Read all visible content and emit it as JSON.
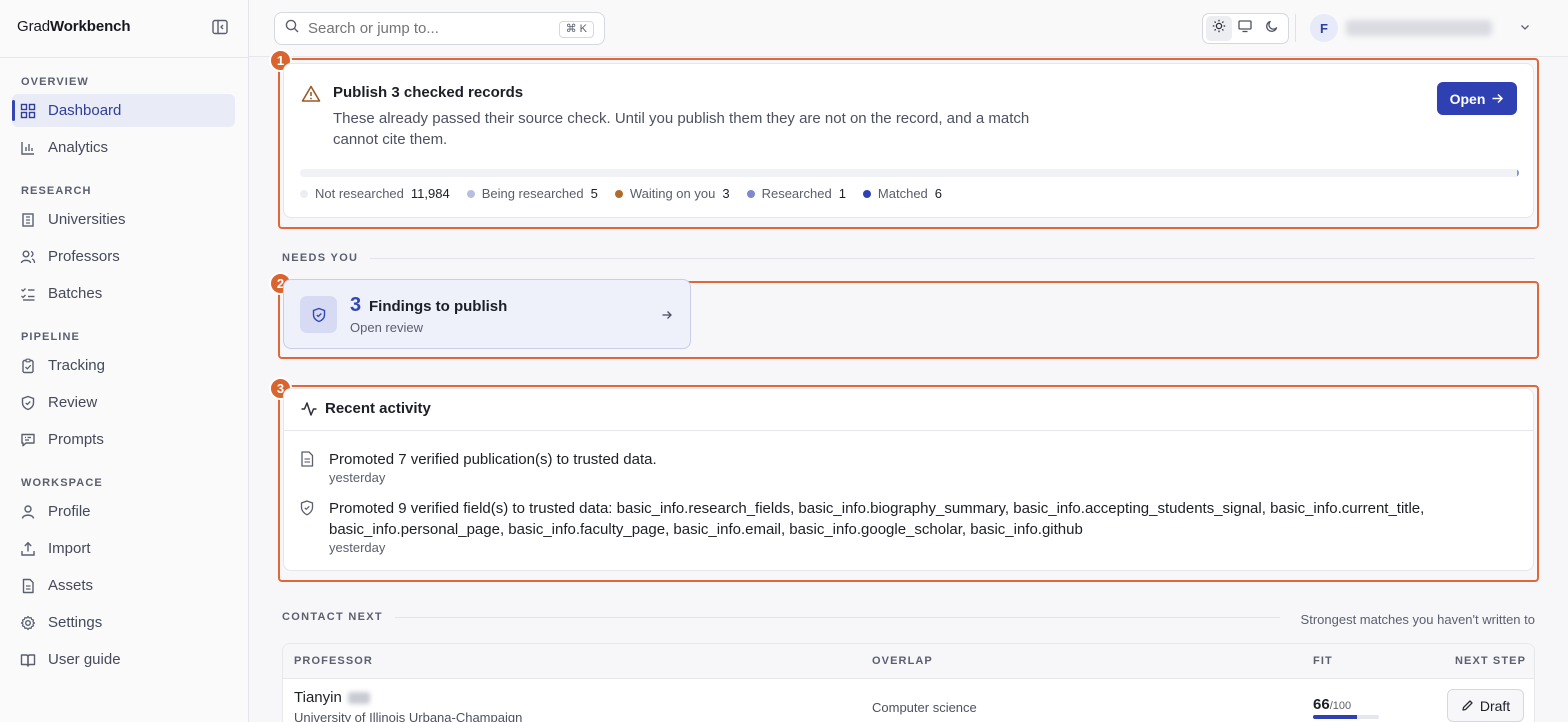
{
  "brand": {
    "prefix": "Grad",
    "bold": "Workbench"
  },
  "sidebar": {
    "groups": [
      {
        "heading": "OVERVIEW",
        "items": [
          {
            "label": "Dashboard",
            "icon": "grid-icon",
            "active": true
          },
          {
            "label": "Analytics",
            "icon": "bar-chart-icon"
          }
        ]
      },
      {
        "heading": "RESEARCH",
        "items": [
          {
            "label": "Universities",
            "icon": "building-icon"
          },
          {
            "label": "Professors",
            "icon": "users-icon"
          },
          {
            "label": "Batches",
            "icon": "list-checks-icon"
          }
        ]
      },
      {
        "heading": "PIPELINE",
        "items": [
          {
            "label": "Tracking",
            "icon": "clipboard-icon"
          },
          {
            "label": "Review",
            "icon": "shield-icon"
          },
          {
            "label": "Prompts",
            "icon": "message-icon"
          }
        ]
      },
      {
        "heading": "WORKSPACE",
        "items": [
          {
            "label": "Profile",
            "icon": "user-icon"
          },
          {
            "label": "Import",
            "icon": "upload-icon"
          },
          {
            "label": "Assets",
            "icon": "file-icon"
          },
          {
            "label": "Settings",
            "icon": "gear-icon"
          },
          {
            "label": "User guide",
            "icon": "book-icon"
          }
        ]
      }
    ]
  },
  "topbar": {
    "search_placeholder": "Search or jump to...",
    "shortcut": "⌘ K",
    "avatar_initial": "F"
  },
  "callout": {
    "badge": "1",
    "title": "Publish 3 checked records",
    "description": "These already passed their source check. Until you publish them they are not on the record, and a match cannot cite them.",
    "open_label": "Open",
    "progress_fill": 0.001,
    "legend": [
      {
        "label": "Not researched",
        "value": "11,984",
        "color": "#eceef2"
      },
      {
        "label": "Being researched",
        "value": "5",
        "color": "#b7bfe0"
      },
      {
        "label": "Waiting on you",
        "value": "3",
        "color": "#b06a2c"
      },
      {
        "label": "Researched",
        "value": "1",
        "color": "#7c88cf"
      },
      {
        "label": "Matched",
        "value": "6",
        "color": "#2f40b2"
      }
    ]
  },
  "needs_you": {
    "heading": "NEEDS YOU",
    "badge": "2",
    "card": {
      "count": "3",
      "title": "Findings to publish",
      "subtitle": "Open review"
    }
  },
  "activity": {
    "badge": "3",
    "title": "Recent activity",
    "items": [
      {
        "text": "Promoted 7 verified publication(s) to trusted data.",
        "time": "yesterday",
        "icon": "document-icon"
      },
      {
        "text": "Promoted 9 verified field(s) to trusted data: basic_info.research_fields, basic_info.biography_summary, basic_info.accepting_students_signal, basic_info.current_title, basic_info.personal_page, basic_info.faculty_page, basic_info.email, basic_info.google_scholar, basic_info.github",
        "time": "yesterday",
        "icon": "shield-check-icon"
      }
    ]
  },
  "contact": {
    "heading": "CONTACT NEXT",
    "note": "Strongest matches you haven't written to",
    "columns": [
      "PROFESSOR",
      "OVERLAP",
      "FIT",
      "NEXT STEP"
    ],
    "rows": [
      {
        "name": "Tianyin",
        "university": "University of Illinois Urbana-Champaign",
        "overlap": "Computer science",
        "fit": "66",
        "fit_max": "/100",
        "fit_fraction": 0.66,
        "action": "Draft"
      }
    ]
  }
}
